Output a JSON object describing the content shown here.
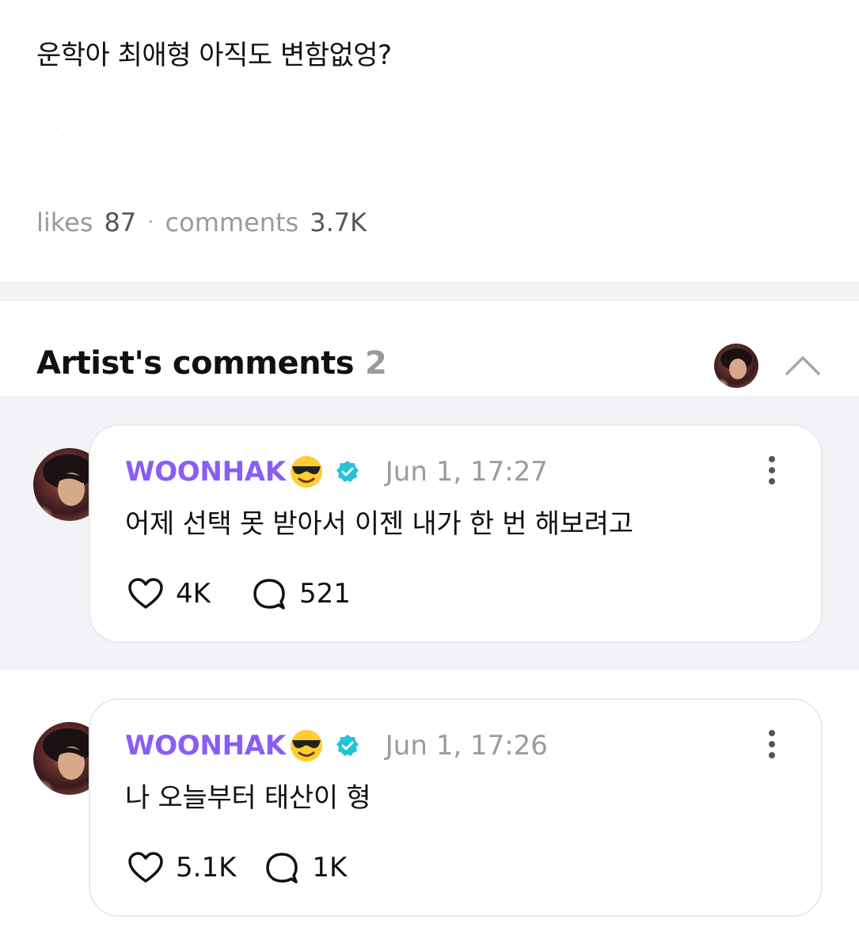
{
  "post": {
    "text": "운학아 최애형 아직도 변함없엉?",
    "likes_label": "likes",
    "likes_count": "87",
    "separator": "·",
    "comments_label": "comments",
    "comments_count": "3.7K"
  },
  "artist_comments": {
    "title": "Artist's comments",
    "count": "2",
    "collapse_icon": "chevron-up-icon",
    "items": [
      {
        "author": "WOONHAK",
        "emoji": "sunglasses-emoji",
        "verified_icon": "verified-badge-icon",
        "time": "Jun 1, 17:27",
        "text": "어제 선택 못 받아서 이젠 내가 한 번 해보려고",
        "likes": "4K",
        "replies": "521"
      },
      {
        "author": "WOONHAK",
        "emoji": "sunglasses-emoji",
        "verified_icon": "verified-badge-icon",
        "time": "Jun 1, 17:26",
        "text": "나 오늘부터 태산이 형",
        "likes": "5.1K",
        "replies": "1K"
      }
    ]
  },
  "colors": {
    "author": "#8b5cf6",
    "verified": "#22c3d6",
    "muted": "#9a9a9a",
    "shaded_bg": "#f1f3f6"
  }
}
